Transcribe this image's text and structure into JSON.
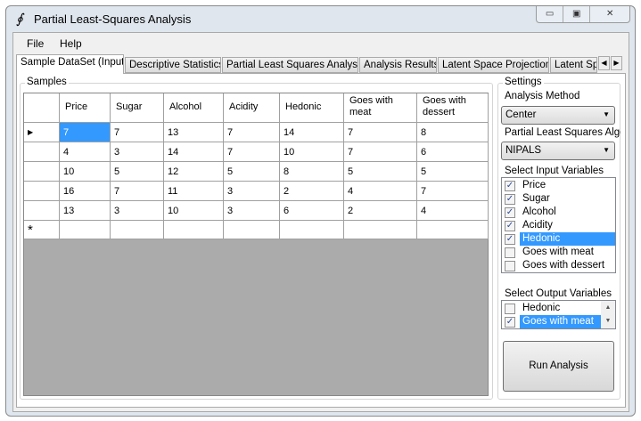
{
  "window": {
    "title": "Partial Least-Squares Analysis",
    "icon": "integral-icon",
    "controls": [
      "minimize",
      "maximize",
      "close"
    ]
  },
  "menu": [
    "File",
    "Help"
  ],
  "tabs": [
    "Sample DataSet (Input)",
    "Descriptive Statistics",
    "Partial Least Squares Analysis",
    "Analysis Results",
    "Latent Space Projection",
    "Latent Sp"
  ],
  "samples": {
    "label": "Samples",
    "columns": [
      "Price",
      "Sugar",
      "Alcohol",
      "Acidity",
      "Hedonic",
      "Goes with meat",
      "Goes with dessert"
    ],
    "rows": [
      [
        "7",
        "7",
        "13",
        "7",
        "14",
        "7",
        "8"
      ],
      [
        "4",
        "3",
        "14",
        "7",
        "10",
        "7",
        "6"
      ],
      [
        "10",
        "5",
        "12",
        "5",
        "8",
        "5",
        "5"
      ],
      [
        "16",
        "7",
        "11",
        "3",
        "2",
        "4",
        "7"
      ],
      [
        "13",
        "3",
        "10",
        "3",
        "6",
        "2",
        "4"
      ]
    ],
    "current_row_marker": "▶",
    "new_row_marker": "*"
  },
  "settings": {
    "label": "Settings",
    "analysis_method_label": "Analysis Method",
    "analysis_method": "Center",
    "algorithm_label": "Partial Least Squares Algori",
    "algorithm": "NIPALS",
    "input_label": "Select Input Variables",
    "inputs": [
      {
        "name": "Price",
        "checked": true
      },
      {
        "name": "Sugar",
        "checked": true
      },
      {
        "name": "Alcohol",
        "checked": true
      },
      {
        "name": "Acidity",
        "checked": true
      },
      {
        "name": "Hedonic",
        "checked": true,
        "selected": true
      },
      {
        "name": "Goes with meat",
        "checked": false
      },
      {
        "name": "Goes with dessert",
        "checked": false
      }
    ],
    "output_label": "Select Output Variables",
    "outputs": [
      {
        "name": "Hedonic",
        "checked": false
      },
      {
        "name": "Goes with meat",
        "checked": true,
        "selected": true
      }
    ],
    "run_label": "Run Analysis"
  },
  "colors": {
    "selection": "#3399ff"
  }
}
